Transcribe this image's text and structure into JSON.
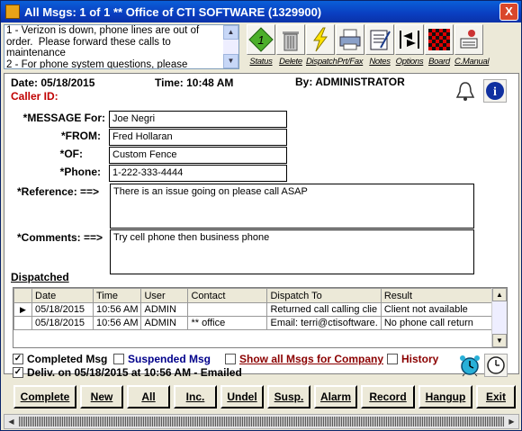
{
  "window": {
    "title": "All Msgs: 1 of 1 ** Office of CTI SOFTWARE (1329900)",
    "close_label": "X"
  },
  "memo": {
    "text": "1 - Verizon is down, phone lines are out of order.  Please forward these calls to maintenance\n2 - For phone system questions, please"
  },
  "toolbar": {
    "items": [
      {
        "label": "Status",
        "icon": "status-diamond-icon"
      },
      {
        "label": "Delete",
        "icon": "trash-can-icon"
      },
      {
        "label": "Dispatch",
        "icon": "lightning-icon"
      },
      {
        "label": "Prt/Fax",
        "icon": "printer-icon"
      },
      {
        "label": "Notes",
        "icon": "notes-icon"
      },
      {
        "label": "Options",
        "icon": "options-arrows-icon"
      },
      {
        "label": "Board",
        "icon": "checkerboard-icon"
      },
      {
        "label": "C.Manual",
        "icon": "manual-icon"
      }
    ]
  },
  "header": {
    "date": "Date: 05/18/2015",
    "time": "Time: 10:48 AM",
    "by": "By: ADMINISTRATOR",
    "caller_id": "Caller ID:"
  },
  "form": {
    "message_for_label": "*MESSAGE For:",
    "message_for": "Joe Negri",
    "from_label": "*FROM:",
    "from": "Fred Hollaran",
    "of_label": "*OF:",
    "of": "Custom Fence",
    "phone_label": "*Phone:",
    "phone": "1-222-333-4444",
    "reference_label": "*Reference: ==>",
    "reference": "There is an issue going on please call ASAP",
    "comments_label": "*Comments: ==>",
    "comments": "Try cell phone then business phone"
  },
  "dispatched": {
    "title": "Dispatched",
    "columns": [
      "Date",
      "Time",
      "User",
      "Contact",
      "Dispatch To",
      "Result"
    ],
    "rows": [
      [
        "05/18/2015",
        "10:56 AM",
        "ADMIN",
        "",
        "Returned call calling clie",
        "Client not available"
      ],
      [
        "05/18/2015",
        "10:56 AM",
        "ADMIN",
        "** office",
        "Email: terri@ctisoftware.",
        "No phone call return"
      ]
    ]
  },
  "checks": {
    "completed": "Completed Msg",
    "suspended": "Suspended Msg",
    "show_all": "Show all Msgs for Company",
    "history": "History",
    "delivered": "Deliv. on 05/18/2015 at 10:56 AM - Emailed"
  },
  "buttons": [
    "Complete",
    "New",
    "All",
    "Inc.",
    "Undel",
    "Susp.",
    "Alarm",
    "Record",
    "Hangup",
    "Exit"
  ],
  "colors": {
    "title_bar": "#0a3ec0",
    "caller_id": "#c00000",
    "suspended": "#00008b",
    "show_all": "#8b0000"
  }
}
